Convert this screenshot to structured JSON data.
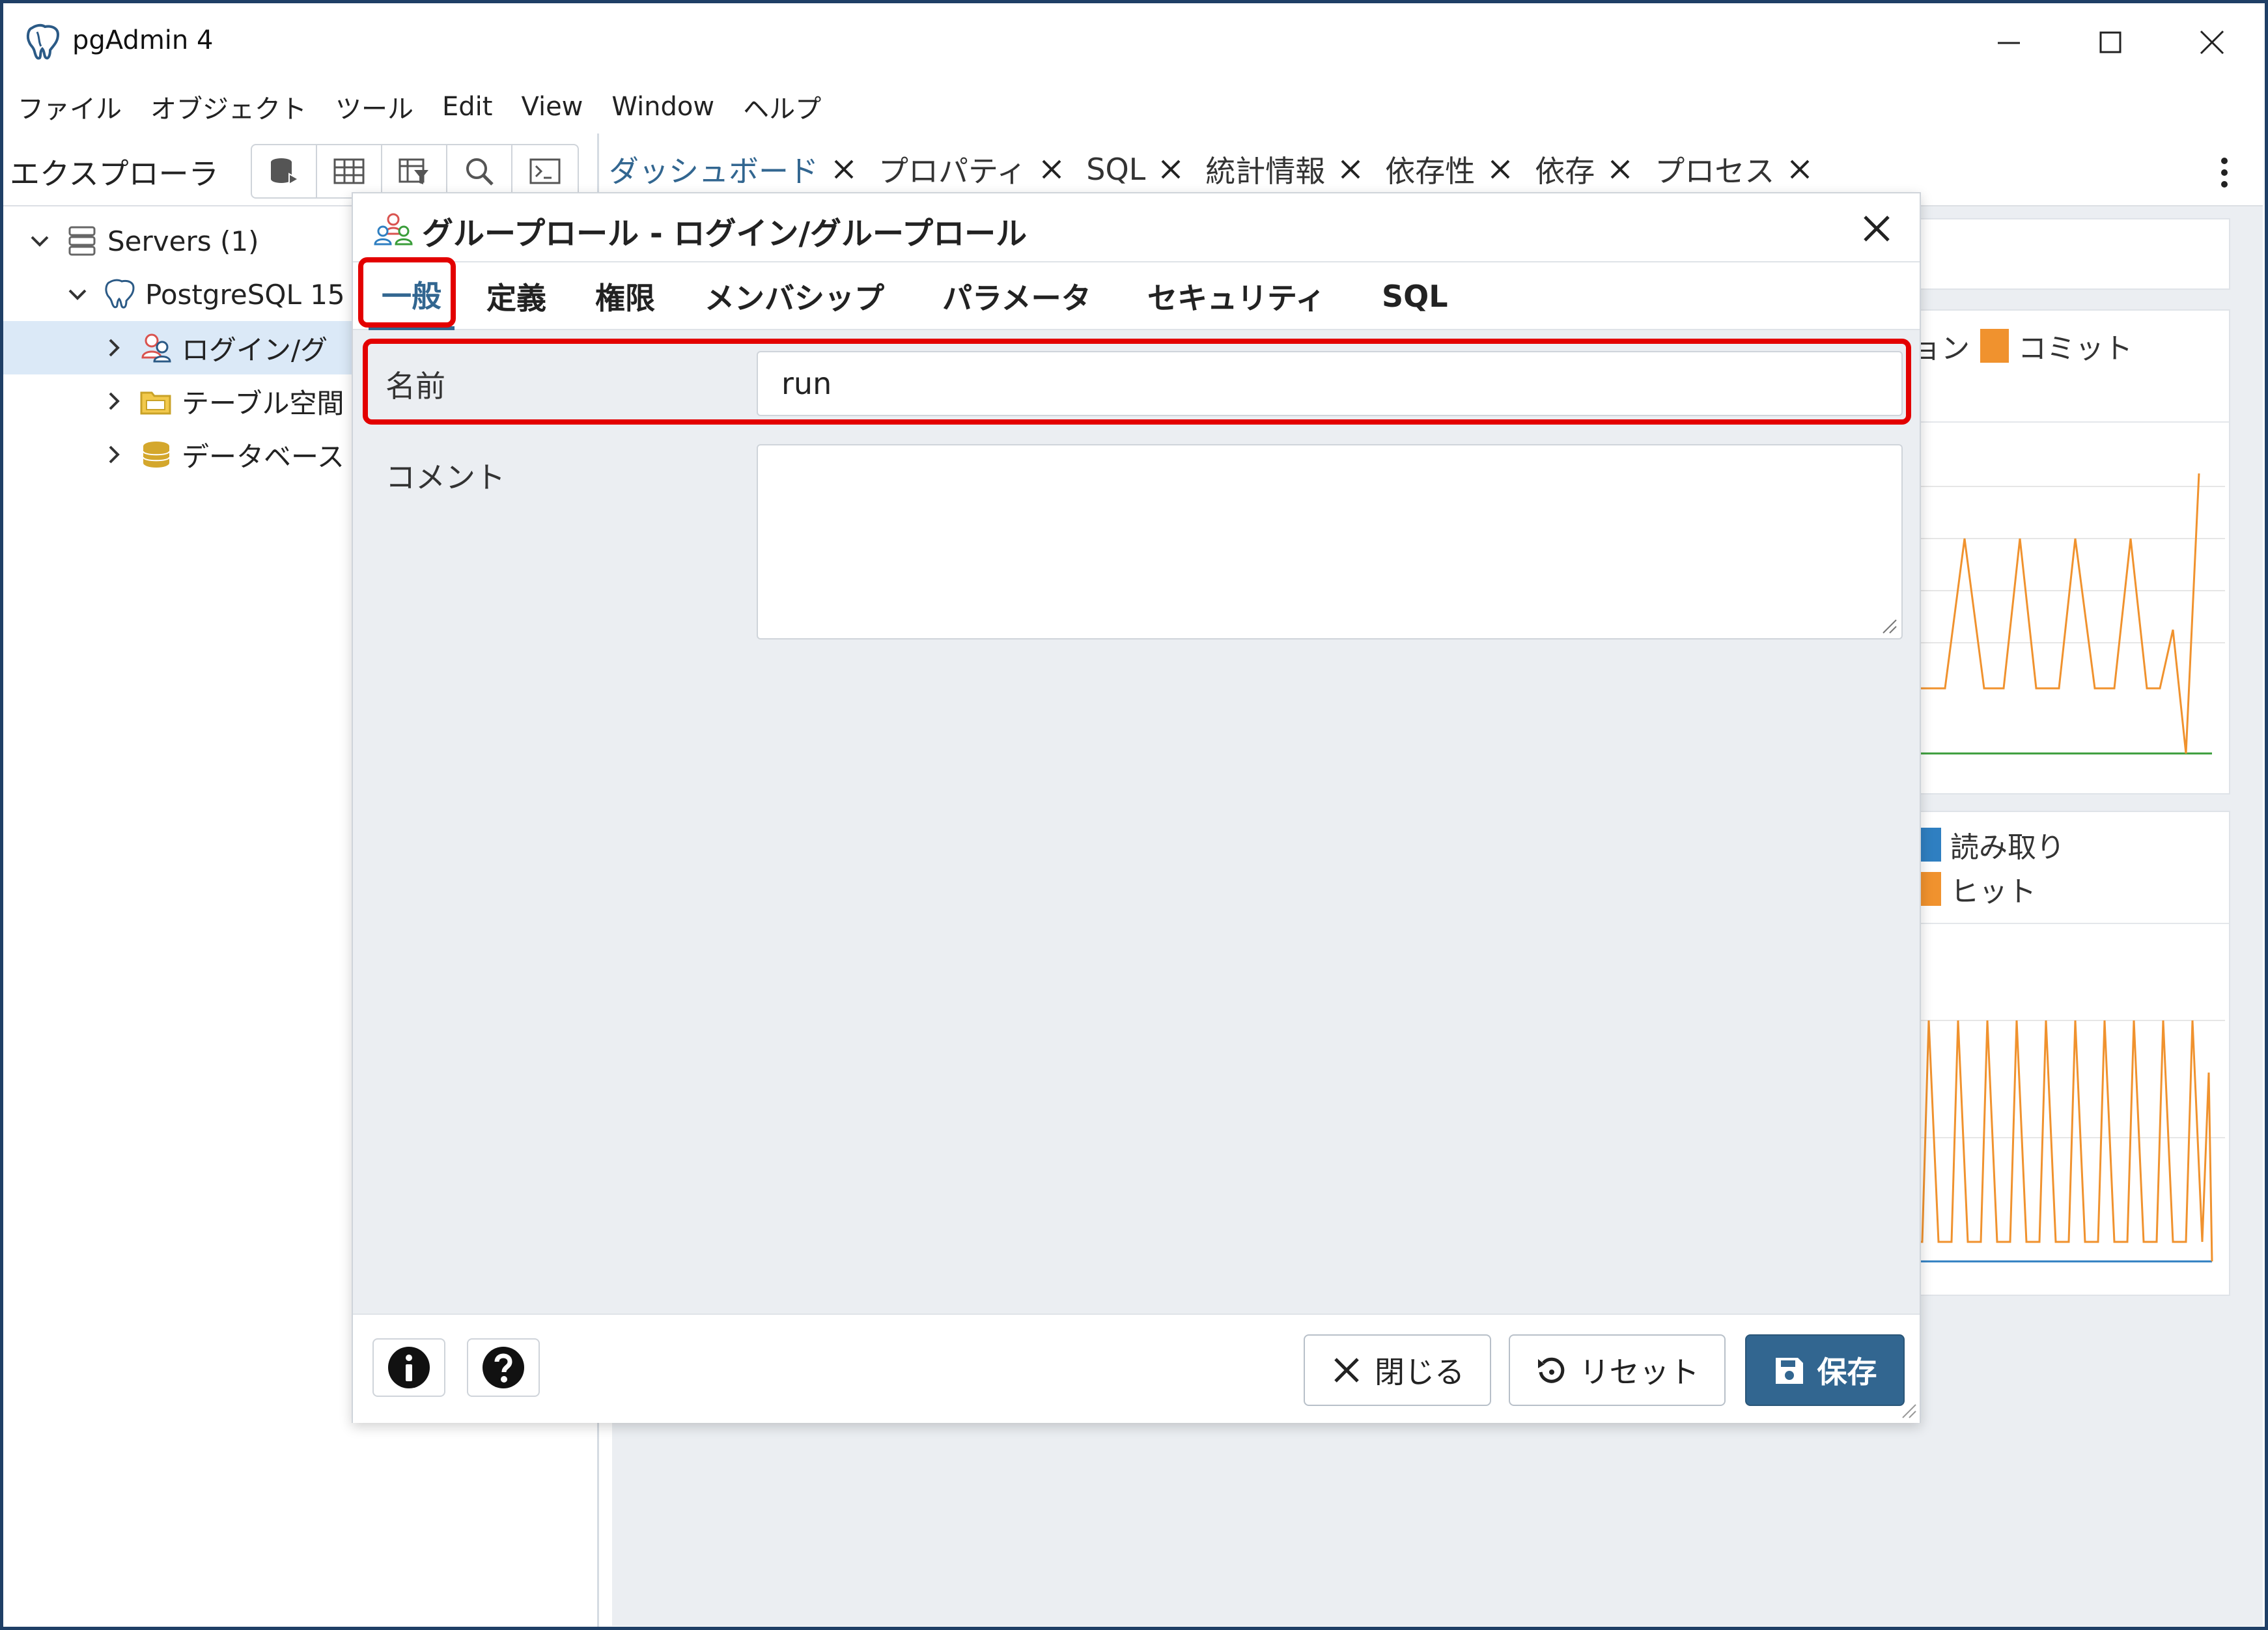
{
  "window": {
    "title": "pgAdmin 4"
  },
  "menu": [
    "ファイル",
    "オブジェクト",
    "ツール",
    "Edit",
    "View",
    "Window",
    "ヘルプ"
  ],
  "explorer": {
    "title": "エクスプローラ",
    "tree": {
      "servers": "Servers (1)",
      "server": "PostgreSQL 15",
      "login_roles": "ログイン/グ",
      "tablespaces": "テーブル空間",
      "databases": "データベース"
    }
  },
  "tabs": [
    "ダッシュボード",
    "プロパティ",
    "SQL",
    "統計情報",
    "依存性",
    "依存",
    "プロセス"
  ],
  "dashboard": {
    "legend_top": [
      "ョン",
      "コミット"
    ],
    "legend_bottom": [
      "読み取り",
      "ヒット"
    ]
  },
  "dialog": {
    "title": "グループロール - ログイン/グループロール",
    "tabs": [
      "一般",
      "定義",
      "権限",
      "メンバシップ",
      "パラメータ",
      "セキュリティ",
      "SQL"
    ],
    "fields": {
      "name_label": "名前",
      "name_value": "run",
      "comment_label": "コメント"
    },
    "buttons": {
      "close": "閉じる",
      "reset": "リセット",
      "save": "保存"
    }
  },
  "colors": {
    "accent": "#326690",
    "highlight": "#e30000",
    "chart_orange": "#f0922e",
    "chart_blue": "#2f7fc1"
  }
}
